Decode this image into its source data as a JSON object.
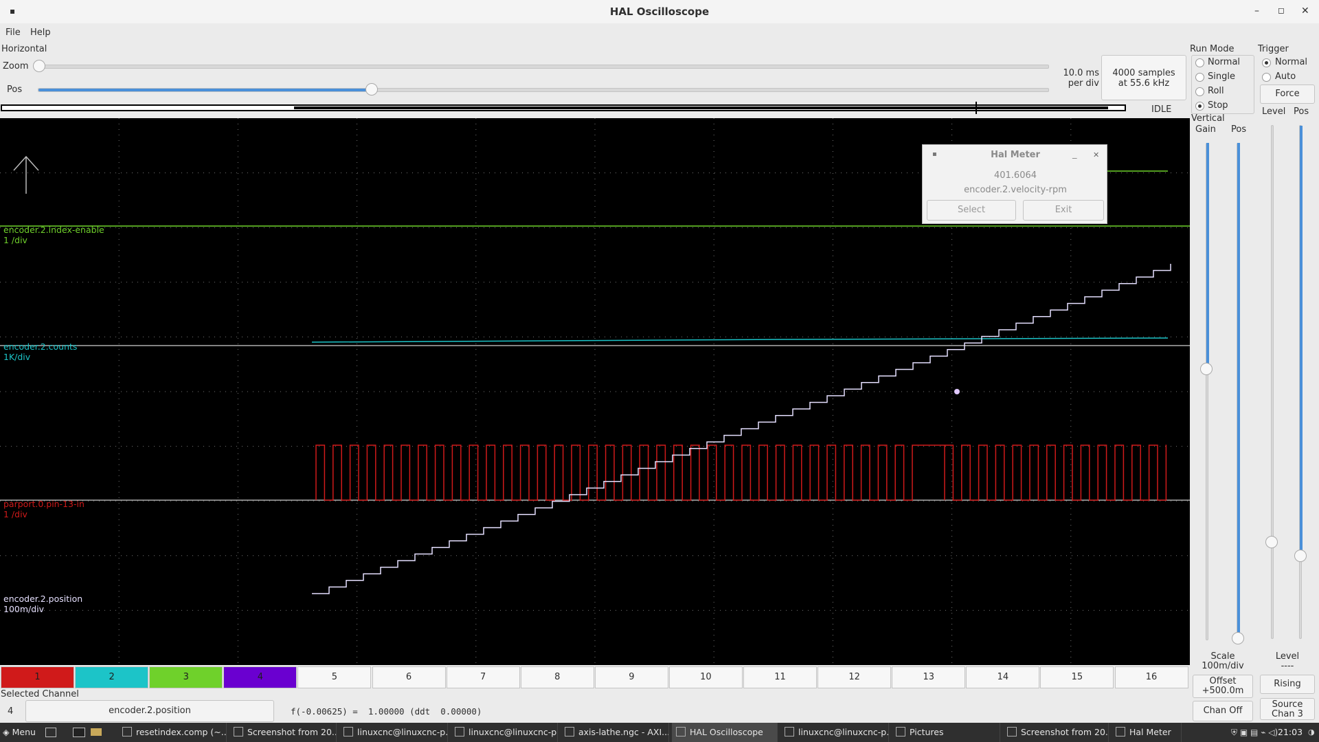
{
  "window": {
    "title": "HAL Oscilloscope"
  },
  "menu": {
    "file": "File",
    "help": "Help"
  },
  "horizontal": {
    "label": "Horizontal",
    "zoom_label": "Zoom",
    "pos_label": "Pos",
    "pos_fraction": 0.33,
    "rate_line1": "10.0 ms",
    "rate_line2": "per div",
    "samples_line1": "4000 samples",
    "samples_line2": "at 55.6 kHz",
    "status": "IDLE"
  },
  "run_mode": {
    "label": "Run Mode",
    "options": [
      "Normal",
      "Single",
      "Roll",
      "Stop"
    ],
    "selected": "Stop"
  },
  "trigger": {
    "label": "Trigger",
    "options": [
      "Normal",
      "Auto"
    ],
    "selected": "Normal",
    "force_label": "Force",
    "level_label": "Level",
    "pos_label": "Pos",
    "level_bottom_label": "Level",
    "level_value": "----",
    "edge_label": "Rising",
    "source_line1": "Source",
    "source_line2": "Chan  3"
  },
  "vertical": {
    "label": "Vertical",
    "gain_label": "Gain",
    "pos_label": "Pos",
    "scale_line1": "Scale",
    "scale_line2": "100m/div",
    "offset_line1": "Offset",
    "offset_line2": "+500.0m",
    "chan_off_label": "Chan Off"
  },
  "channels": [
    {
      "name": "encoder.2.index-enable",
      "scale": "1 /div",
      "color": "#6fd12b"
    },
    {
      "name": "encoder.2.counts",
      "scale": "1K/div",
      "color": "#1cc4c8"
    },
    {
      "name": "parport.0.pin-13-in",
      "scale": "1 /div",
      "color": "#d01a1a"
    },
    {
      "name": "encoder.2.position",
      "scale": "100m/div",
      "color": "#e6e0ff"
    }
  ],
  "channel_buttons": [
    {
      "label": "1",
      "color": "#d01a1a"
    },
    {
      "label": "2",
      "color": "#1cc4c8"
    },
    {
      "label": "3",
      "color": "#6fd12b"
    },
    {
      "label": "4",
      "color": "#6a00d0"
    },
    {
      "label": "5"
    },
    {
      "label": "6"
    },
    {
      "label": "7"
    },
    {
      "label": "8"
    },
    {
      "label": "9"
    },
    {
      "label": "10"
    },
    {
      "label": "11"
    },
    {
      "label": "12"
    },
    {
      "label": "13"
    },
    {
      "label": "14"
    },
    {
      "label": "15"
    },
    {
      "label": "16"
    }
  ],
  "selected_channel": {
    "label": "Selected Channel",
    "number": "4",
    "name": "encoder.2.position",
    "readout": "f(-0.00625) =  1.00000 (ddt  0.00000)"
  },
  "hal_meter": {
    "title": "Hal Meter",
    "value": "401.6064",
    "pin": "encoder.2.velocity-rpm",
    "select_label": "Select",
    "exit_label": "Exit"
  },
  "taskbar": {
    "menu_label": "Menu",
    "tasks": [
      "resetindex.comp (~...",
      "Screenshot from 20...",
      "linuxcnc@linuxcnc-p...",
      "linuxcnc@linuxcnc-p...",
      "axis-lathe.ngc - AXI...",
      "HAL Oscilloscope",
      "linuxcnc@linuxcnc-p...",
      "Pictures",
      "Screenshot from 20...",
      "Hal Meter"
    ],
    "active_task": 5,
    "clock": "21:03"
  }
}
